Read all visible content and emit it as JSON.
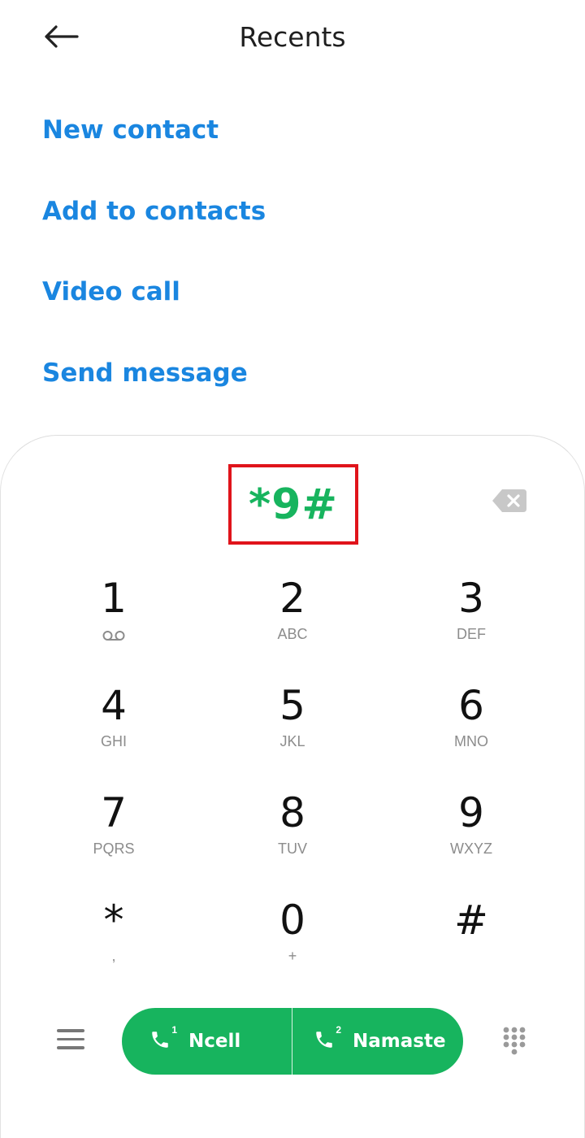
{
  "header": {
    "title": "Recents"
  },
  "actions": [
    {
      "label": "New contact"
    },
    {
      "label": "Add to contacts"
    },
    {
      "label": "Video call"
    },
    {
      "label": "Send message"
    }
  ],
  "dialer": {
    "display": "*9#"
  },
  "keypad": [
    [
      {
        "digit": "1",
        "sub": "",
        "sub_icon": "voicemail-icon"
      },
      {
        "digit": "2",
        "sub": "ABC"
      },
      {
        "digit": "3",
        "sub": "DEF"
      }
    ],
    [
      {
        "digit": "4",
        "sub": "GHI"
      },
      {
        "digit": "5",
        "sub": "JKL"
      },
      {
        "digit": "6",
        "sub": "MNO"
      }
    ],
    [
      {
        "digit": "7",
        "sub": "PQRS"
      },
      {
        "digit": "8",
        "sub": "TUV"
      },
      {
        "digit": "9",
        "sub": "WXYZ"
      }
    ],
    [
      {
        "digit": "*",
        "sub": ","
      },
      {
        "digit": "0",
        "sub": "+"
      },
      {
        "digit": "#",
        "sub": ""
      }
    ]
  ],
  "call_buttons": [
    {
      "sim": "1",
      "label": "Ncell"
    },
    {
      "sim": "2",
      "label": "Namaste"
    }
  ],
  "colors": {
    "accent_blue": "#1a86e0",
    "call_green": "#17b45e",
    "highlight_red": "#e0141b"
  }
}
